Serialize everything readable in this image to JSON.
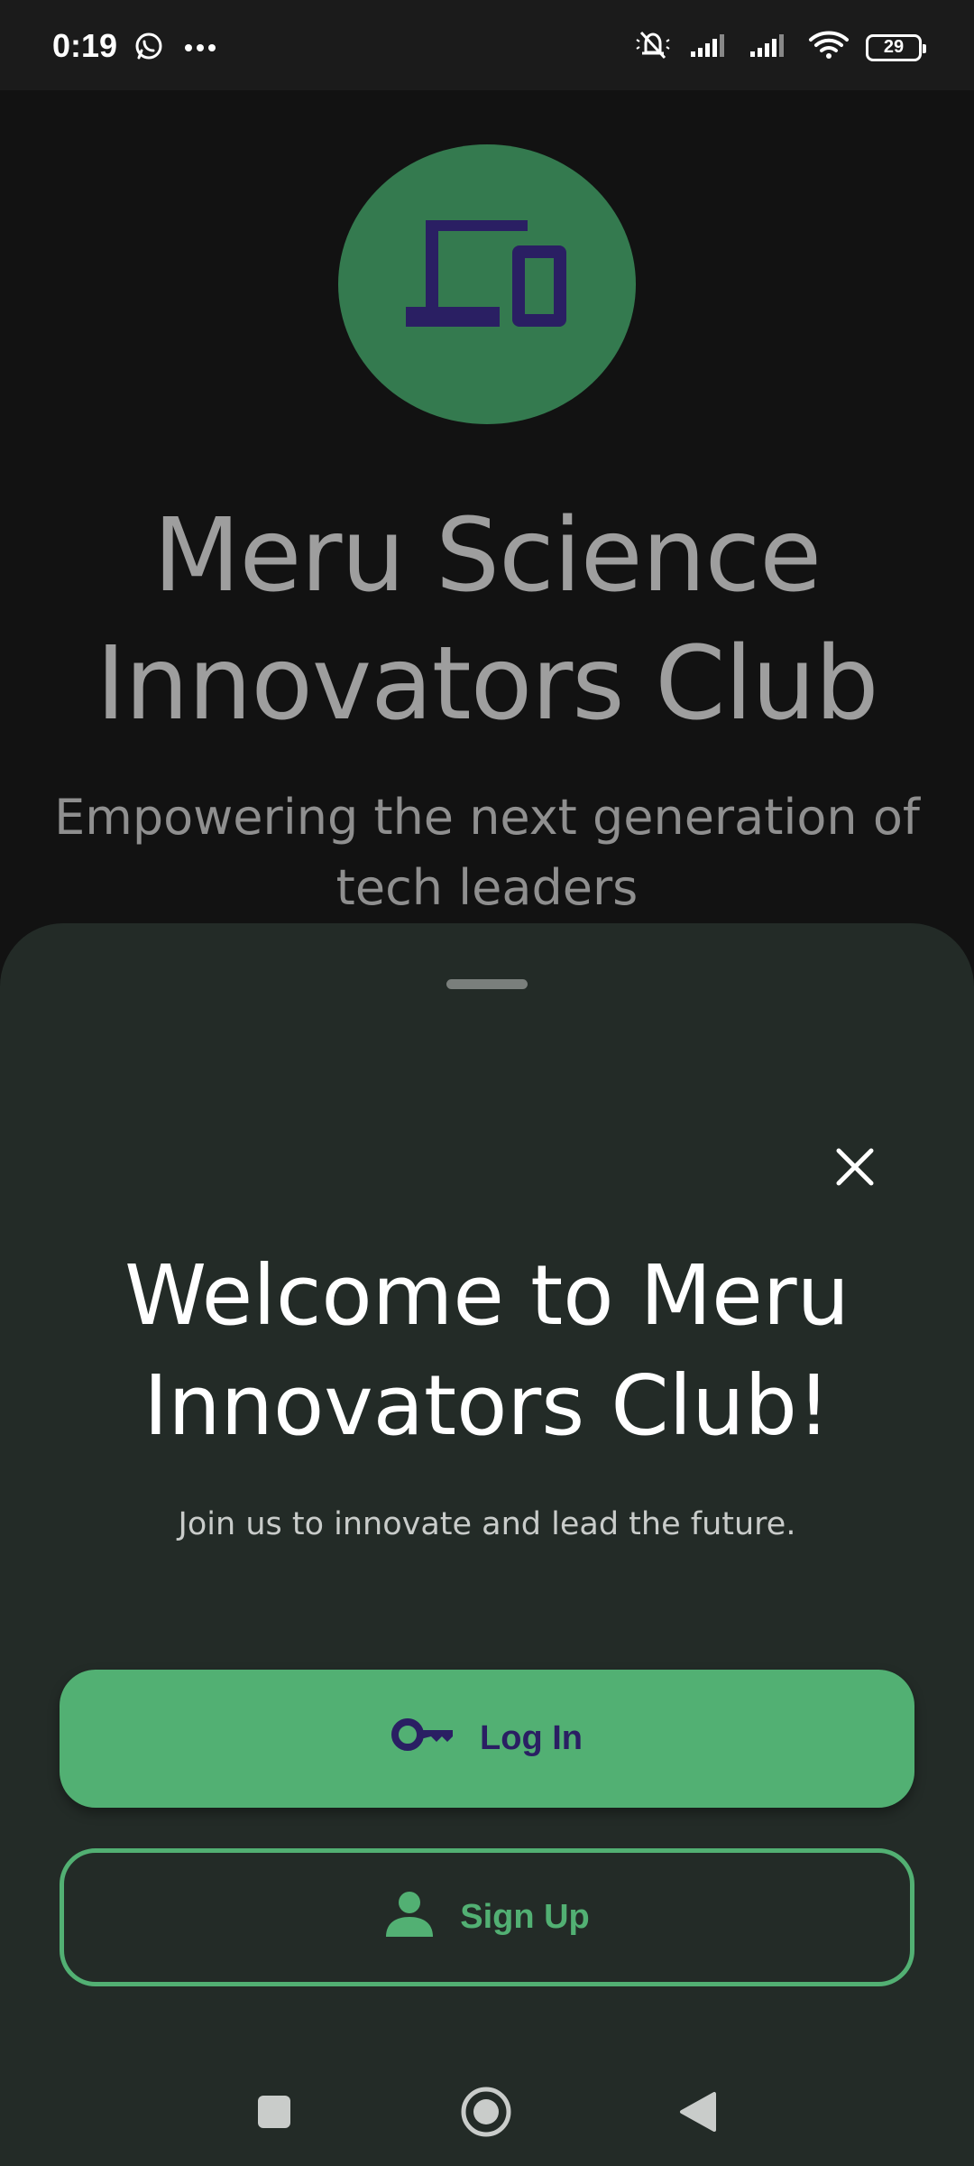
{
  "status_bar": {
    "time": "0:19",
    "battery": "29",
    "icons": [
      "whatsapp-icon",
      "more-dots-icon",
      "mute-icon",
      "signal-icon",
      "signal-icon",
      "wifi-icon",
      "battery-icon"
    ]
  },
  "background": {
    "title": "Meru Science Innovators Club",
    "subtitle": "Empowering the next generation of tech leaders",
    "logo_icon": "devices-icon",
    "logo_color": "#347a4f",
    "logo_icon_color": "#2a1f63"
  },
  "sheet": {
    "title": "Welcome to Meru Innovators Club!",
    "subtitle": "Join us to innovate and lead the future.",
    "close_icon": "close-icon",
    "login_label": "Log In",
    "login_icon": "key-icon",
    "signup_label": "Sign Up",
    "signup_icon": "person-icon",
    "accent_color": "#52b073",
    "sheet_color": "#232b27"
  },
  "nav_bar": {
    "items": [
      "recents-square-icon",
      "home-circle-icon",
      "back-triangle-icon"
    ]
  }
}
